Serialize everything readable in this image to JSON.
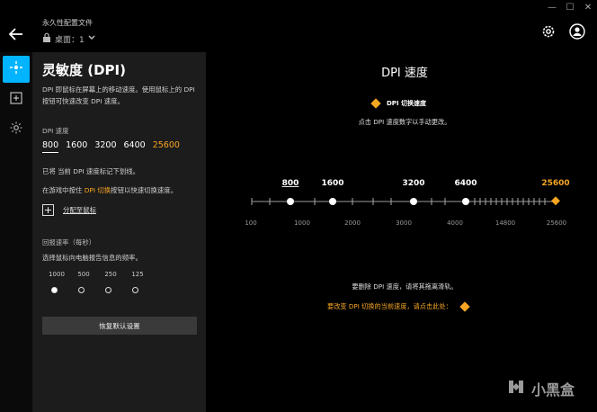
{
  "window": {
    "minimize": "—",
    "maximize": "☐",
    "close": "✕"
  },
  "header": {
    "profile_label": "永久性配置文件",
    "desktop_label": "桌面：1"
  },
  "panel": {
    "title": "灵敏度 (DPI)",
    "description": "DPI 即鼠标在屏幕上的移动速度。使用鼠标上的 DPI 按钮可快速改变 DPI 速度。",
    "dpi_speed_label": "DPI 速度",
    "dpi_values": [
      "800",
      "1600",
      "3200",
      "6400",
      "25600"
    ],
    "current_dpi_index": 0,
    "shift_dpi_index": 4,
    "note_current": "已将 当前 DPI 速度标记下划线。",
    "note_shift_prefix": "在游戏中按住 ",
    "note_shift_highlight": "DPI 切换",
    "note_shift_suffix": "按钮以快速切换速度。",
    "assign_label": "分配至鼠标",
    "report_rate_label": "回报速率（每秒）",
    "report_rate_desc": "选择鼠标向电脑报告信息的频率。",
    "report_rates": [
      "1000",
      "500",
      "250",
      "125"
    ],
    "selected_rate_index": 0,
    "reset_label": "恢复默认设置"
  },
  "main": {
    "title": "DPI 速度",
    "shift_label": "DPI 切换速度",
    "click_hint": "点击 DPI 速度数字以手动更改。",
    "slider_stops": [
      "800",
      "1600",
      "3200",
      "6400",
      "25600"
    ],
    "axis_ticks": [
      "100",
      "1000",
      "2000",
      "3000",
      "4000",
      "14800",
      "25600"
    ],
    "delete_hint": "要删除 DPI 速度，请将其拖离滑轨。",
    "shift_hint": "要改变 DPI 切换的当前速度，请点击此处："
  },
  "colors": {
    "accent": "#00b4ff",
    "shift": "#f6a623"
  },
  "watermark": {
    "text": "小黑盒"
  }
}
